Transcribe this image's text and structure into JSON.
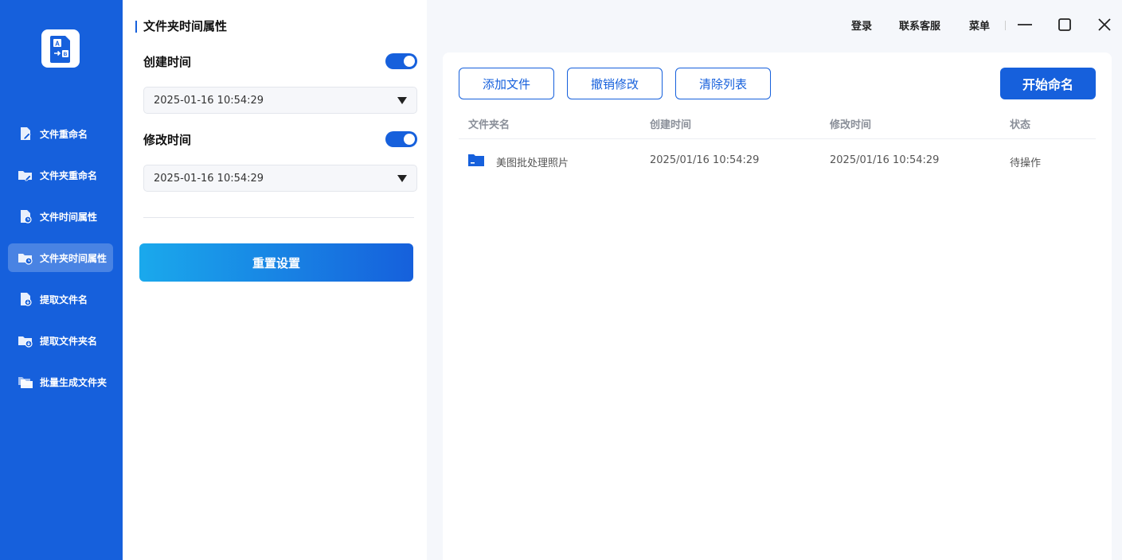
{
  "sidebar": {
    "logo_icon": "translate-file-icon",
    "items": [
      {
        "label": "文件重命名",
        "icon": "file-rename-icon"
      },
      {
        "label": "文件夹重命名",
        "icon": "folder-rename-icon"
      },
      {
        "label": "文件时间属性",
        "icon": "file-clock-icon"
      },
      {
        "label": "文件夹时间属性",
        "icon": "folder-clock-icon",
        "active": true
      },
      {
        "label": "提取文件名",
        "icon": "file-extract-icon"
      },
      {
        "label": "提取文件夹名",
        "icon": "folder-extract-icon"
      },
      {
        "label": "批量生成文件夹",
        "icon": "folders-icon"
      }
    ],
    "bg_color": "#1660dc"
  },
  "panel": {
    "title": "文件夹时间属性",
    "create_time": {
      "label": "创建时间",
      "enabled": true,
      "value": "2025-01-16 10:54:29"
    },
    "modify_time": {
      "label": "修改时间",
      "enabled": true,
      "value": "2025-01-16 10:54:29"
    },
    "reset_label": "重置设置"
  },
  "topbar": {
    "login": "登录",
    "support": "联系客服",
    "menu": "菜单"
  },
  "toolbar": {
    "add_file": "添加文件",
    "undo": "撤销修改",
    "clear": "清除列表",
    "start": "开始命名"
  },
  "table": {
    "headers": [
      "文件夹名",
      "创建时间",
      "修改时间",
      "状态"
    ],
    "rows": [
      {
        "name": "美图批处理照片",
        "created": "2025/01/16 10:54:29",
        "modified": "2025/01/16 10:54:29",
        "status": "待操作"
      }
    ]
  },
  "colors": {
    "accent": "#1660dc",
    "gradient_start": "#1aa9ec"
  }
}
